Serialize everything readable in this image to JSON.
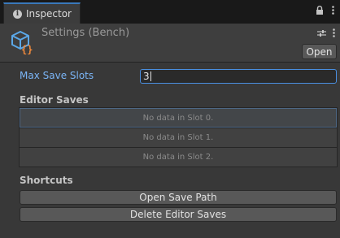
{
  "window": {
    "tab_label": "Inspector",
    "tab_icon": "info-icon"
  },
  "header": {
    "title": "Settings (Bench)",
    "open_label": "Open",
    "asset_icon": "scriptable-object-icon"
  },
  "field": {
    "label": "Max Save Slots",
    "value": "3"
  },
  "editor_saves": {
    "heading": "Editor Saves",
    "slots": [
      "No data in Slot 0.",
      "No data in Slot 1.",
      "No data in Slot 2."
    ]
  },
  "shortcuts": {
    "heading": "Shortcuts",
    "open_path_label": "Open Save Path",
    "delete_label": "Delete Editor Saves"
  },
  "colors": {
    "background": "#383838",
    "accent": "#4a8fe0",
    "label_blue": "#7ab4f5",
    "asset_orange": "#f08a3c",
    "asset_blue": "#5ba8e8"
  }
}
